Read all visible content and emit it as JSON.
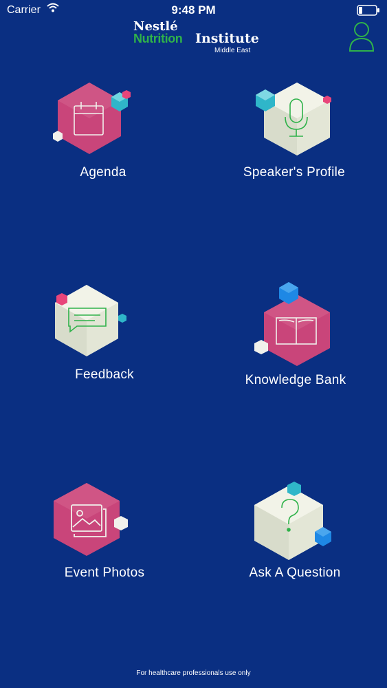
{
  "status_bar": {
    "carrier": "Carrier",
    "time": "9:48 PM"
  },
  "header": {
    "logo_line1": "Nestlé",
    "logo_green": "Nutrition",
    "logo_white": "Institute",
    "logo_region": "Middle East"
  },
  "menu": {
    "agenda": "Agenda",
    "speakers_profile": "Speaker's Profile",
    "feedback": "Feedback",
    "knowledge_bank": "Knowledge Bank",
    "event_photos": "Event Photos",
    "ask_a_question": "Ask A Question"
  },
  "footer": {
    "note": "For healthcare professionals use only"
  },
  "colors": {
    "background": "#0a2f82",
    "accent_green": "#2fb24a",
    "tile_pink": "#c9457a",
    "tile_cream": "#eef0e2",
    "cube_teal": "#2fb6c9",
    "cube_blue": "#1e88e5"
  },
  "icons": {
    "profile": "user-icon",
    "agenda": "calendar-icon",
    "speakers_profile": "microphone-icon",
    "feedback": "chat-bubble-icon",
    "knowledge_bank": "book-icon",
    "event_photos": "photos-icon",
    "ask_a_question": "question-mark-icon"
  }
}
